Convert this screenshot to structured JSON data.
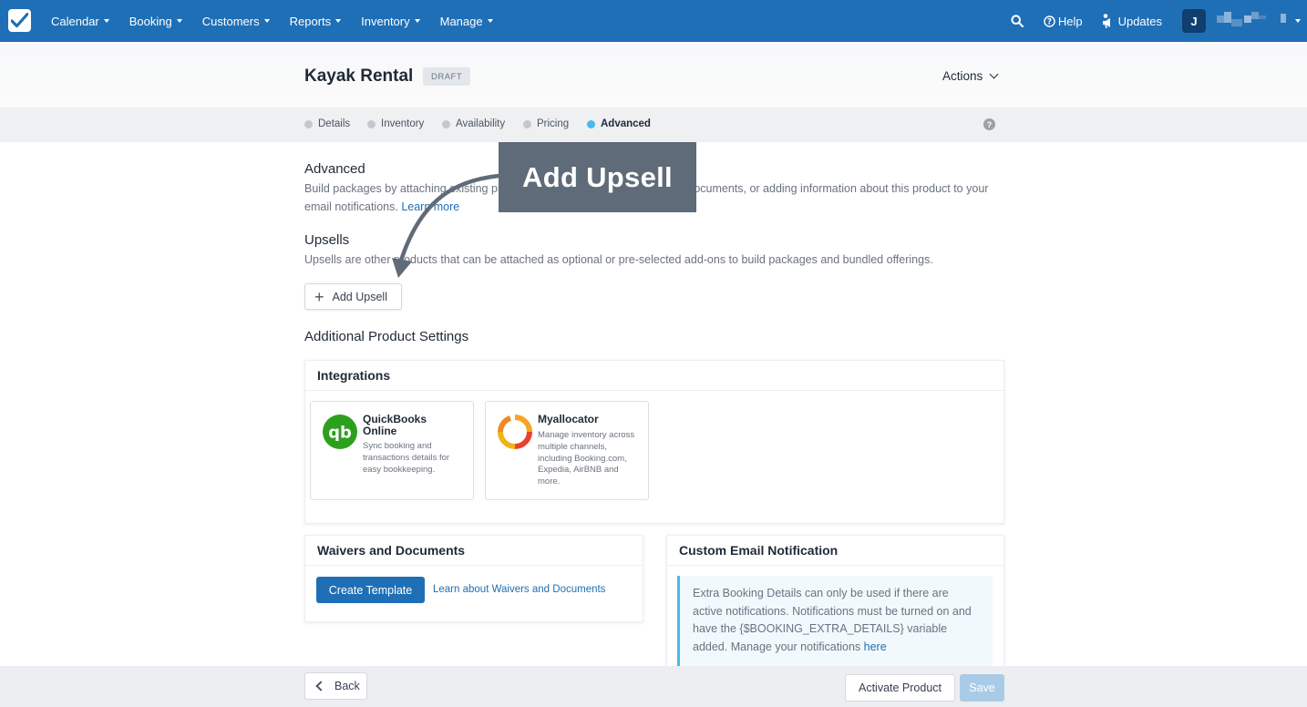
{
  "nav": {
    "items": [
      {
        "label": "Calendar"
      },
      {
        "label": "Booking"
      },
      {
        "label": "Customers"
      },
      {
        "label": "Reports"
      },
      {
        "label": "Inventory"
      },
      {
        "label": "Manage"
      }
    ],
    "help_label": "Help",
    "updates_label": "Updates",
    "avatar_initial": "J"
  },
  "header": {
    "title": "Kayak Rental",
    "status_badge": "DRAFT",
    "actions_label": "Actions"
  },
  "steps": [
    {
      "label": "Details",
      "active": false
    },
    {
      "label": "Inventory",
      "active": false
    },
    {
      "label": "Availability",
      "active": false
    },
    {
      "label": "Pricing",
      "active": false
    },
    {
      "label": "Advanced",
      "active": true
    }
  ],
  "advanced": {
    "title": "Advanced",
    "description": "Build packages by attaching existing products as upsells, adding waivers or documents, or adding information about this product to your email notifications.",
    "learn_more": "Learn more"
  },
  "upsells": {
    "title": "Upsells",
    "description": "Upsells are other products that can be attached as optional or pre-selected add-ons to build packages and bundled offerings.",
    "add_button": "Add Upsell"
  },
  "additional": {
    "title": "Additional Product Settings"
  },
  "integrations": {
    "title": "Integrations",
    "items": [
      {
        "name": "QuickBooks Online",
        "description": "Sync booking and transactions details for easy bookkeeping."
      },
      {
        "name": "Myallocator",
        "description": "Manage inventory across multiple channels, including Booking.com, Expedia, AirBNB and more."
      }
    ]
  },
  "waivers": {
    "title": "Waivers and Documents",
    "create_button": "Create Template",
    "learn_link": "Learn about Waivers and Documents"
  },
  "email": {
    "title": "Custom Email Notification",
    "notice_text": "Extra Booking Details can only be used if there are active notifications. Notifications must be turned on and have the {$BOOKING_EXTRA_DETAILS} variable added. Manage your notifications",
    "notice_link": "here"
  },
  "footer": {
    "back_label": "Back",
    "activate_label": "Activate Product",
    "save_label": "Save"
  },
  "annotation": {
    "callout_text": "Add Upsell"
  },
  "colors": {
    "nav_bg": "#1f6fb6",
    "active_step": "#49b9ea",
    "quickbooks_green": "#2ca01c",
    "callout_bg": "#5f6b78"
  }
}
